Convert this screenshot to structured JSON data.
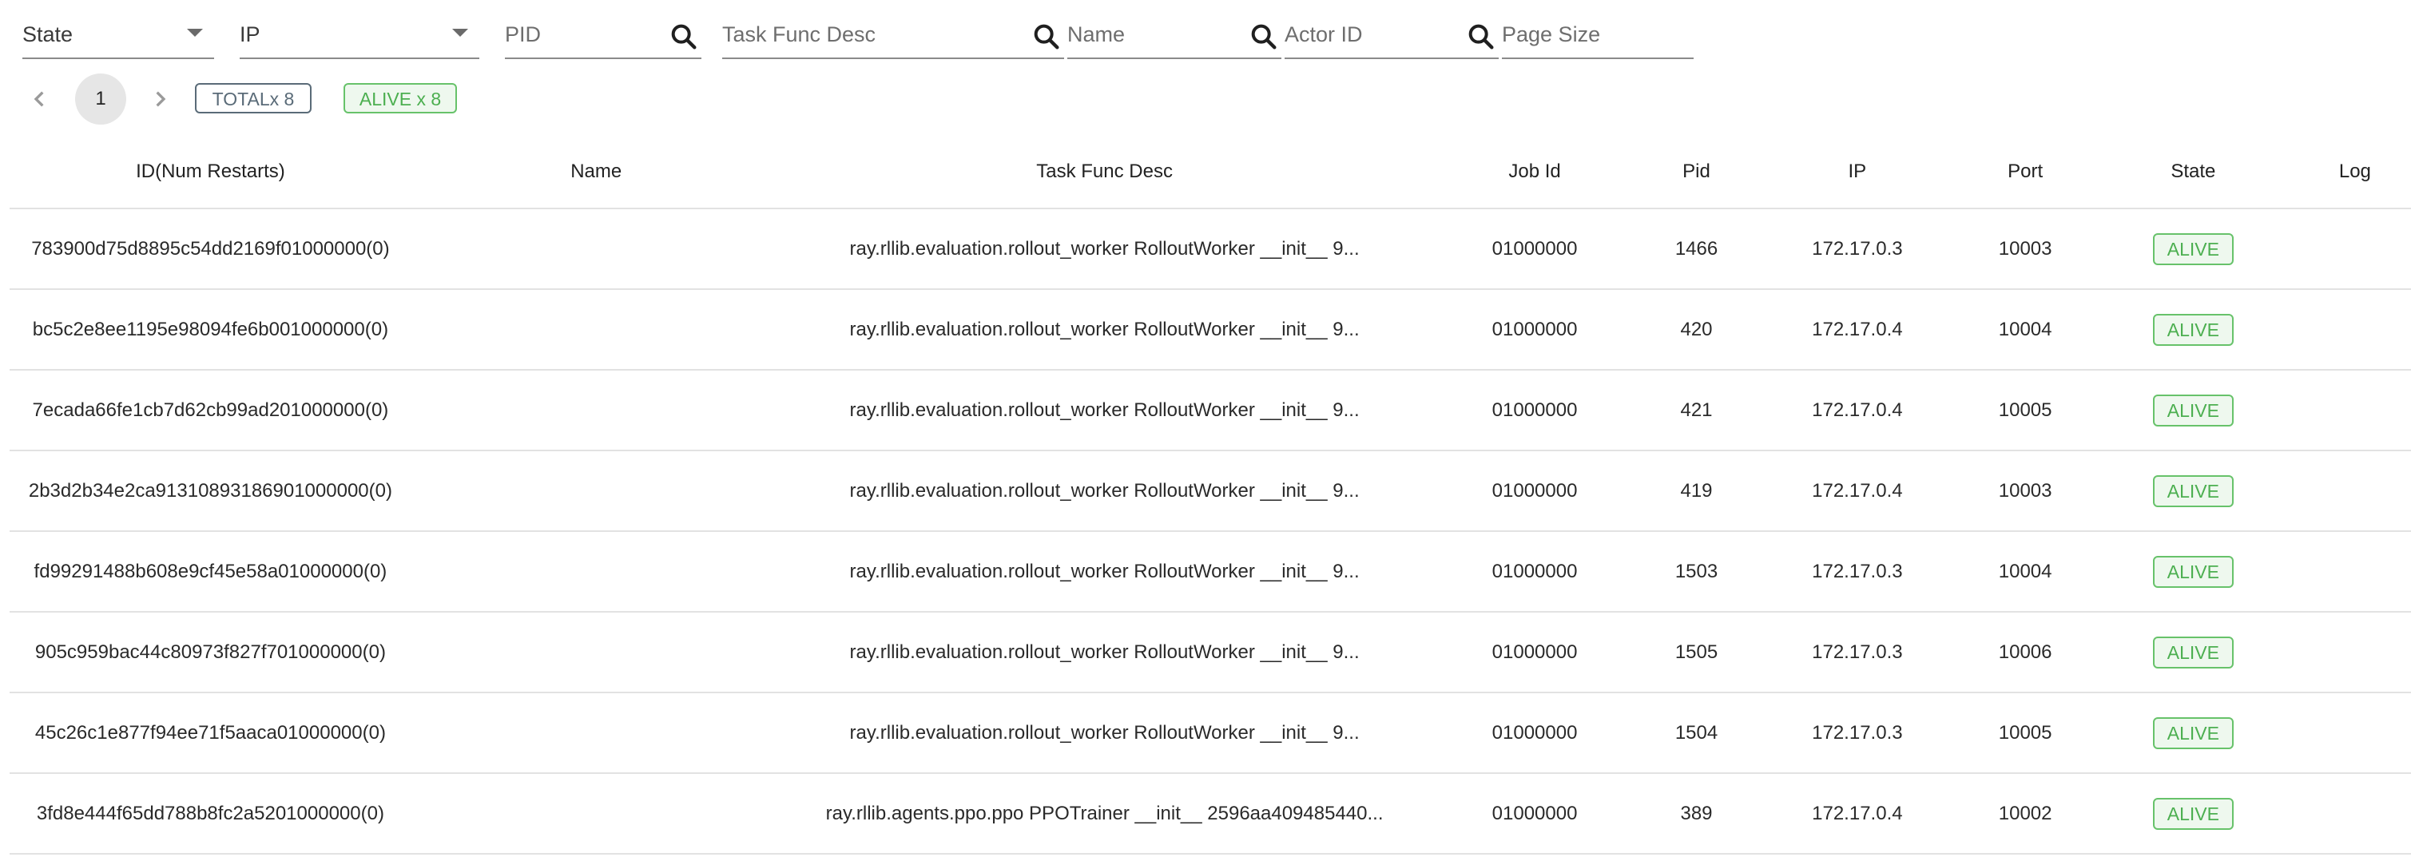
{
  "filters": {
    "state_label": "State",
    "ip_label": "IP",
    "pid_label": "PID",
    "task_func_desc_label": "Task Func Desc",
    "name_label": "Name",
    "actor_id_label": "Actor ID",
    "page_size_label": "Page Size"
  },
  "pagination": {
    "current_page": "1",
    "total_tag": "TOTALx 8",
    "alive_tag": "ALIVE x 8"
  },
  "table": {
    "headers": {
      "id": "ID(Num Restarts)",
      "name": "Name",
      "task_func_desc": "Task Func Desc",
      "job_id": "Job Id",
      "pid": "Pid",
      "ip": "IP",
      "port": "Port",
      "state": "State",
      "log": "Log"
    },
    "rows": [
      {
        "id": "783900d75d8895c54dd2169f01000000(0)",
        "name": "",
        "task": "ray.rllib.evaluation.rollout_worker RolloutWorker __init__ 9...",
        "job": "01000000",
        "pid": "1466",
        "ip": "172.17.0.3",
        "port": "10003",
        "state": "ALIVE"
      },
      {
        "id": "bc5c2e8ee1195e98094fe6b001000000(0)",
        "name": "",
        "task": "ray.rllib.evaluation.rollout_worker RolloutWorker __init__ 9...",
        "job": "01000000",
        "pid": "420",
        "ip": "172.17.0.4",
        "port": "10004",
        "state": "ALIVE"
      },
      {
        "id": "7ecada66fe1cb7d62cb99ad201000000(0)",
        "name": "",
        "task": "ray.rllib.evaluation.rollout_worker RolloutWorker __init__ 9...",
        "job": "01000000",
        "pid": "421",
        "ip": "172.17.0.4",
        "port": "10005",
        "state": "ALIVE"
      },
      {
        "id": "2b3d2b34e2ca91310893186901000000(0)",
        "name": "",
        "task": "ray.rllib.evaluation.rollout_worker RolloutWorker __init__ 9...",
        "job": "01000000",
        "pid": "419",
        "ip": "172.17.0.4",
        "port": "10003",
        "state": "ALIVE"
      },
      {
        "id": "fd99291488b608e9cf45e58a01000000(0)",
        "name": "",
        "task": "ray.rllib.evaluation.rollout_worker RolloutWorker __init__ 9...",
        "job": "01000000",
        "pid": "1503",
        "ip": "172.17.0.3",
        "port": "10004",
        "state": "ALIVE"
      },
      {
        "id": "905c959bac44c80973f827f701000000(0)",
        "name": "",
        "task": "ray.rllib.evaluation.rollout_worker RolloutWorker __init__ 9...",
        "job": "01000000",
        "pid": "1505",
        "ip": "172.17.0.3",
        "port": "10006",
        "state": "ALIVE"
      },
      {
        "id": "45c26c1e877f94ee71f5aaca01000000(0)",
        "name": "",
        "task": "ray.rllib.evaluation.rollout_worker RolloutWorker __init__ 9...",
        "job": "01000000",
        "pid": "1504",
        "ip": "172.17.0.3",
        "port": "10005",
        "state": "ALIVE"
      },
      {
        "id": "3fd8e444f65dd788b8fc2a5201000000(0)",
        "name": "",
        "task": "ray.rllib.agents.ppo.ppo PPOTrainer __init__ 2596aa409485440...",
        "job": "01000000",
        "pid": "389",
        "ip": "172.17.0.4",
        "port": "10002",
        "state": "ALIVE"
      }
    ]
  },
  "colors": {
    "alive_green": "#4caf50",
    "total_slate": "#5a6b78",
    "divider": "#e2e2e2"
  },
  "icons": {
    "search": "search-icon",
    "dropdown": "triangle-down-icon",
    "prev": "chevron-left-icon",
    "next": "chevron-right-icon"
  }
}
